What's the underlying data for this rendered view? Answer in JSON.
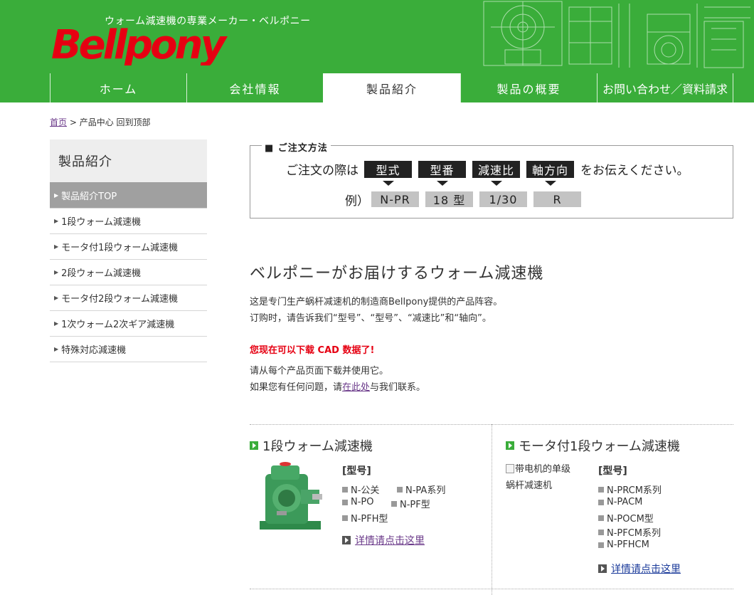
{
  "header": {
    "tagline": "ウォーム減速機の専業メーカー・ベルポニー",
    "logo_text": "Bellpony",
    "brand_color": "#3aad3a",
    "logo_color": "#e60012"
  },
  "nav": {
    "items": [
      {
        "label": "ホーム"
      },
      {
        "label": "会社情報"
      },
      {
        "label": "製品紹介"
      },
      {
        "label": "製品の概要"
      },
      {
        "label": "お問い合わせ／資料請求"
      }
    ]
  },
  "breadcrumb": {
    "home": "首页",
    "separator": ">",
    "current": "产品中心 回到顶部"
  },
  "sidebar": {
    "title": "製品紹介",
    "items": [
      {
        "label": "製品紹介TOP"
      },
      {
        "label": "1段ウォーム減速機"
      },
      {
        "label": "モータ付1段ウォーム減速機"
      },
      {
        "label": "2段ウォーム減速機"
      },
      {
        "label": "モータ付2段ウォーム減速機"
      },
      {
        "label": "1次ウォーム2次ギア減速機"
      },
      {
        "label": "特殊対応減速機"
      }
    ]
  },
  "order": {
    "legend": "■ ご注文方法",
    "prefix": "ご注文の際は",
    "suffix": "をお伝えください。",
    "fields": [
      "型式",
      "型番",
      "減速比",
      "軸方向"
    ],
    "example_label": "例）",
    "examples": [
      "N-PR",
      "18 型",
      "1/30",
      "R"
    ]
  },
  "main": {
    "heading": "ベルポニーがお届けするウォーム減速機",
    "intro_line1": "这是专门生产蜗杆减速机的制造商Bellpony提供的产品阵容。",
    "intro_line2": "订购时，请告诉我们“型号”、“型号”、“减速比”和“轴向”。",
    "cad_notice": "您现在可以下载 CAD 数据了!",
    "download_line": "请从每个产品页面下载并使用它。",
    "contact_before": "如果您有任何问题，请",
    "contact_link": "在此处",
    "contact_after": "与我们联系。"
  },
  "products": [
    {
      "title": "1段ウォーム減速機",
      "model_header": "[型号]",
      "models": [
        "N-公关",
        "N-PA系列",
        "N-PO",
        "N-PF型",
        "N-PFH型"
      ],
      "detail_link": "详情请点击这里",
      "image_icon": "worm-gear-reducer-image"
    },
    {
      "title": "モータ付1段ウォーム減速機",
      "image_alt_line1": "带电机的单级",
      "image_alt_line2": "蜗杆减速机",
      "model_header": "[型号]",
      "models": [
        "N-PRCM系列",
        "N-PACM",
        "N-POCM型",
        "N-PFCM系列",
        "N-PFHCM"
      ],
      "detail_link": "详情请点击这里"
    }
  ]
}
